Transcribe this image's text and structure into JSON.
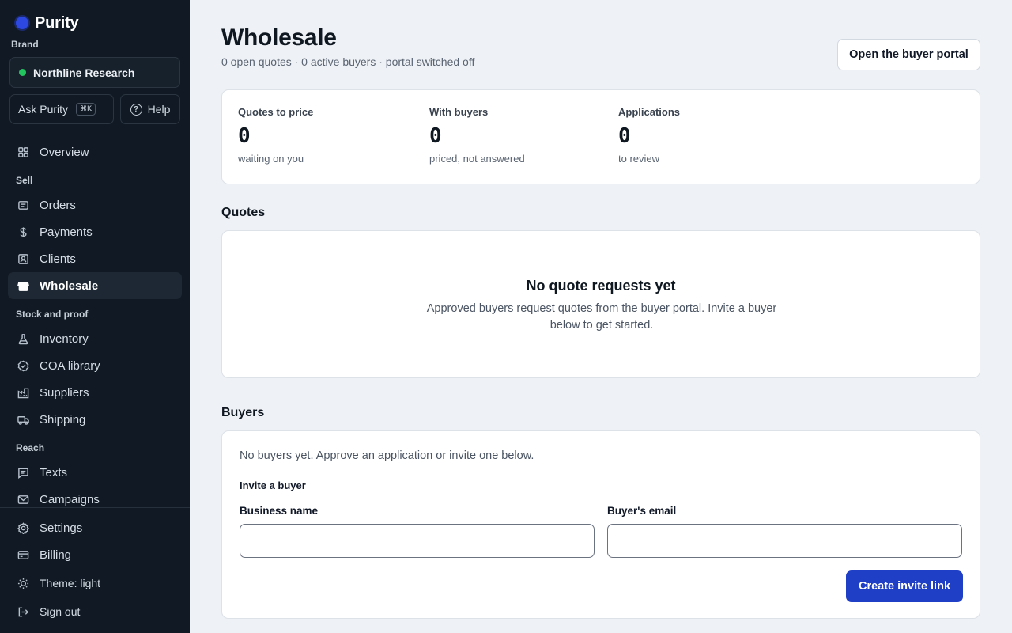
{
  "app": {
    "name": "Purity"
  },
  "sidebar": {
    "brand_label": "Brand",
    "brand_name": "Northline Research",
    "ask_label": "Ask Purity",
    "ask_shortcut": "⌘K",
    "help_label": "Help",
    "overview": "Overview",
    "sections": {
      "sell": "Sell",
      "stock": "Stock and proof",
      "reach": "Reach"
    },
    "items": {
      "orders": "Orders",
      "payments": "Payments",
      "clients": "Clients",
      "wholesale": "Wholesale",
      "inventory": "Inventory",
      "coa": "COA library",
      "suppliers": "Suppliers",
      "shipping": "Shipping",
      "texts": "Texts",
      "campaigns": "Campaigns",
      "settings": "Settings",
      "billing": "Billing",
      "theme": "Theme: light",
      "signout": "Sign out"
    },
    "active_item": "wholesale"
  },
  "header": {
    "title": "Wholesale",
    "subtitle": "0 open quotes · 0 active buyers · portal switched off",
    "portal_button": "Open the buyer portal"
  },
  "stats": [
    {
      "label": "Quotes to price",
      "value": "0",
      "sub": "waiting on you"
    },
    {
      "label": "With buyers",
      "value": "0",
      "sub": "priced, not answered"
    },
    {
      "label": "Applications",
      "value": "0",
      "sub": "to review"
    }
  ],
  "quotes": {
    "title": "Quotes",
    "empty_title": "No quote requests yet",
    "empty_body": "Approved buyers request quotes from the buyer portal. Invite a buyer below to get started."
  },
  "buyers": {
    "title": "Buyers",
    "empty_text": "No buyers yet. Approve an application or invite one below.",
    "invite_title": "Invite a buyer",
    "business_label": "Business name",
    "business_value": "",
    "email_label": "Buyer's email",
    "email_value": "",
    "create_button": "Create invite link"
  },
  "colors": {
    "sidebar_bg": "#111a24",
    "page_bg": "#eef1f5",
    "accent": "#1f3fc7",
    "brand_dot": "#2d48e0",
    "status_green": "#22c55e"
  }
}
